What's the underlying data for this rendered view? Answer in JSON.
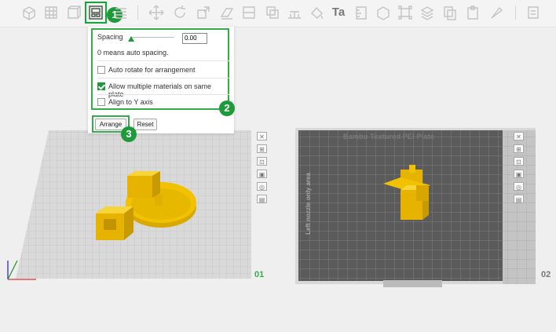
{
  "toolbar": {
    "tools": [
      "add-part-icon",
      "grid-icon",
      "arrange-icon",
      "list-icon",
      "move-icon",
      "rotate-icon",
      "scale-icon",
      "lay-on-face-icon",
      "cut-icon",
      "boolean-icon",
      "support-icon",
      "seam-icon",
      "text-icon",
      "measure-icon",
      "assembly-icon",
      "split-icon",
      "layers-icon",
      "copy-icon",
      "paste-icon",
      "brush-icon",
      "settings-icon"
    ],
    "text_tool_glyph": "Ta"
  },
  "callouts": [
    "1",
    "2",
    "3"
  ],
  "arrange_panel": {
    "spacing_label": "Spacing",
    "spacing_value": "0.00",
    "spacing_hint": "0 means auto spacing.",
    "auto_rotate_label": "Auto rotate for arrangement",
    "auto_rotate_checked": false,
    "multi_materials_label": "Allow multiple materials on same plate",
    "multi_materials_checked": true,
    "align_y_label": "Align to Y axis",
    "align_y_checked": false,
    "arrange_button": "Arrange",
    "reset_button": "Reset"
  },
  "plates": {
    "left": {
      "number": "01"
    },
    "right": {
      "number": "02",
      "plate_title": "Bambu Textured PEI Plate",
      "side_note": "Left nozzle only area"
    }
  },
  "colors": {
    "accent": "#1f9a3a",
    "model": "#f2c200",
    "plate_dark": "#585858",
    "plate_light": "#d6d6d6"
  }
}
